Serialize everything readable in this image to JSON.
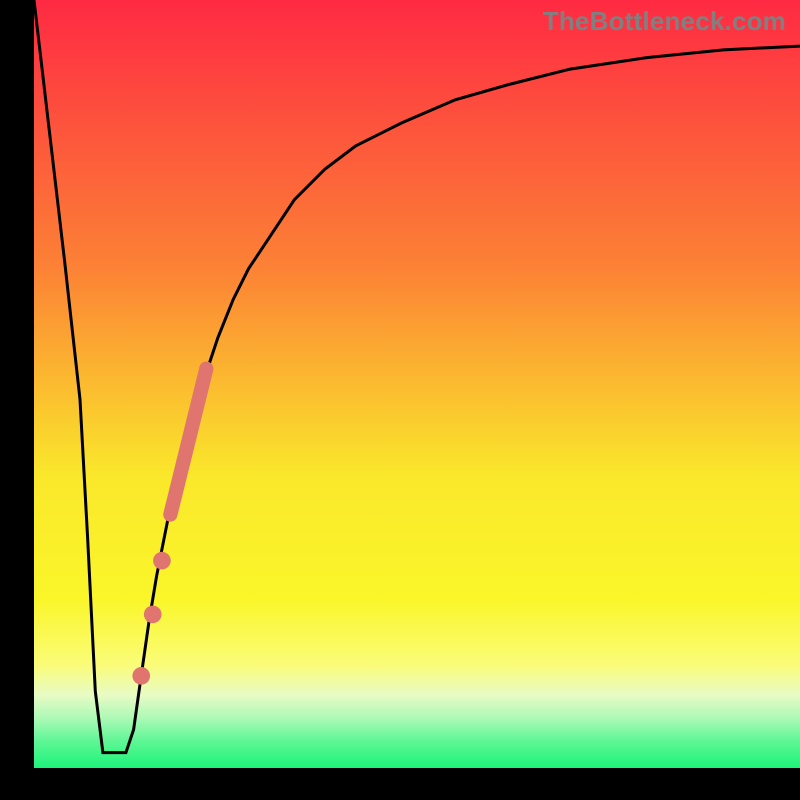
{
  "watermark": "TheBottleneck.com",
  "palette": {
    "frame": "#000000",
    "curve": "#000000",
    "marker_fill": "#e07570",
    "gradient_stops": [
      {
        "offset": 0.0,
        "color": "#fe2a43"
      },
      {
        "offset": 0.35,
        "color": "#fc8235"
      },
      {
        "offset": 0.62,
        "color": "#fae82b"
      },
      {
        "offset": 0.78,
        "color": "#faf62a"
      },
      {
        "offset": 0.865,
        "color": "#fafc77"
      },
      {
        "offset": 0.905,
        "color": "#e8fbc5"
      },
      {
        "offset": 0.935,
        "color": "#acf9b6"
      },
      {
        "offset": 0.965,
        "color": "#5ef695"
      },
      {
        "offset": 1.0,
        "color": "#1cf47a"
      }
    ]
  },
  "chart_data": {
    "type": "line",
    "title": "",
    "xlabel": "",
    "ylabel": "",
    "xlim": [
      0,
      100
    ],
    "ylim": [
      0,
      100
    ],
    "grid": false,
    "legend": false,
    "series": [
      {
        "name": "bottleneck-curve",
        "x": [
          0,
          2,
          4,
          6,
          7,
          8,
          9,
          10,
          11,
          12,
          13,
          14,
          15,
          16,
          18,
          20,
          22,
          24,
          26,
          28,
          30,
          34,
          38,
          42,
          48,
          55,
          62,
          70,
          80,
          90,
          100
        ],
        "y": [
          100,
          83,
          66,
          48,
          30,
          10,
          2,
          2,
          2,
          2,
          5,
          12,
          19,
          25,
          35,
          43,
          50,
          56,
          61,
          65,
          68,
          74,
          78,
          81,
          84,
          87,
          89,
          91,
          92.5,
          93.5,
          94
        ]
      }
    ],
    "markers": {
      "name": "highlighted-segment",
      "points": [
        {
          "x": 14.0,
          "y": 12.0,
          "r": 1.0
        },
        {
          "x": 15.5,
          "y": 20.0,
          "r": 1.0
        },
        {
          "x": 16.7,
          "y": 27.0,
          "r": 1.0
        }
      ],
      "bar": {
        "x1": 17.8,
        "y1": 33.0,
        "x2": 22.5,
        "y2": 52.0,
        "width": 2.4
      }
    }
  }
}
